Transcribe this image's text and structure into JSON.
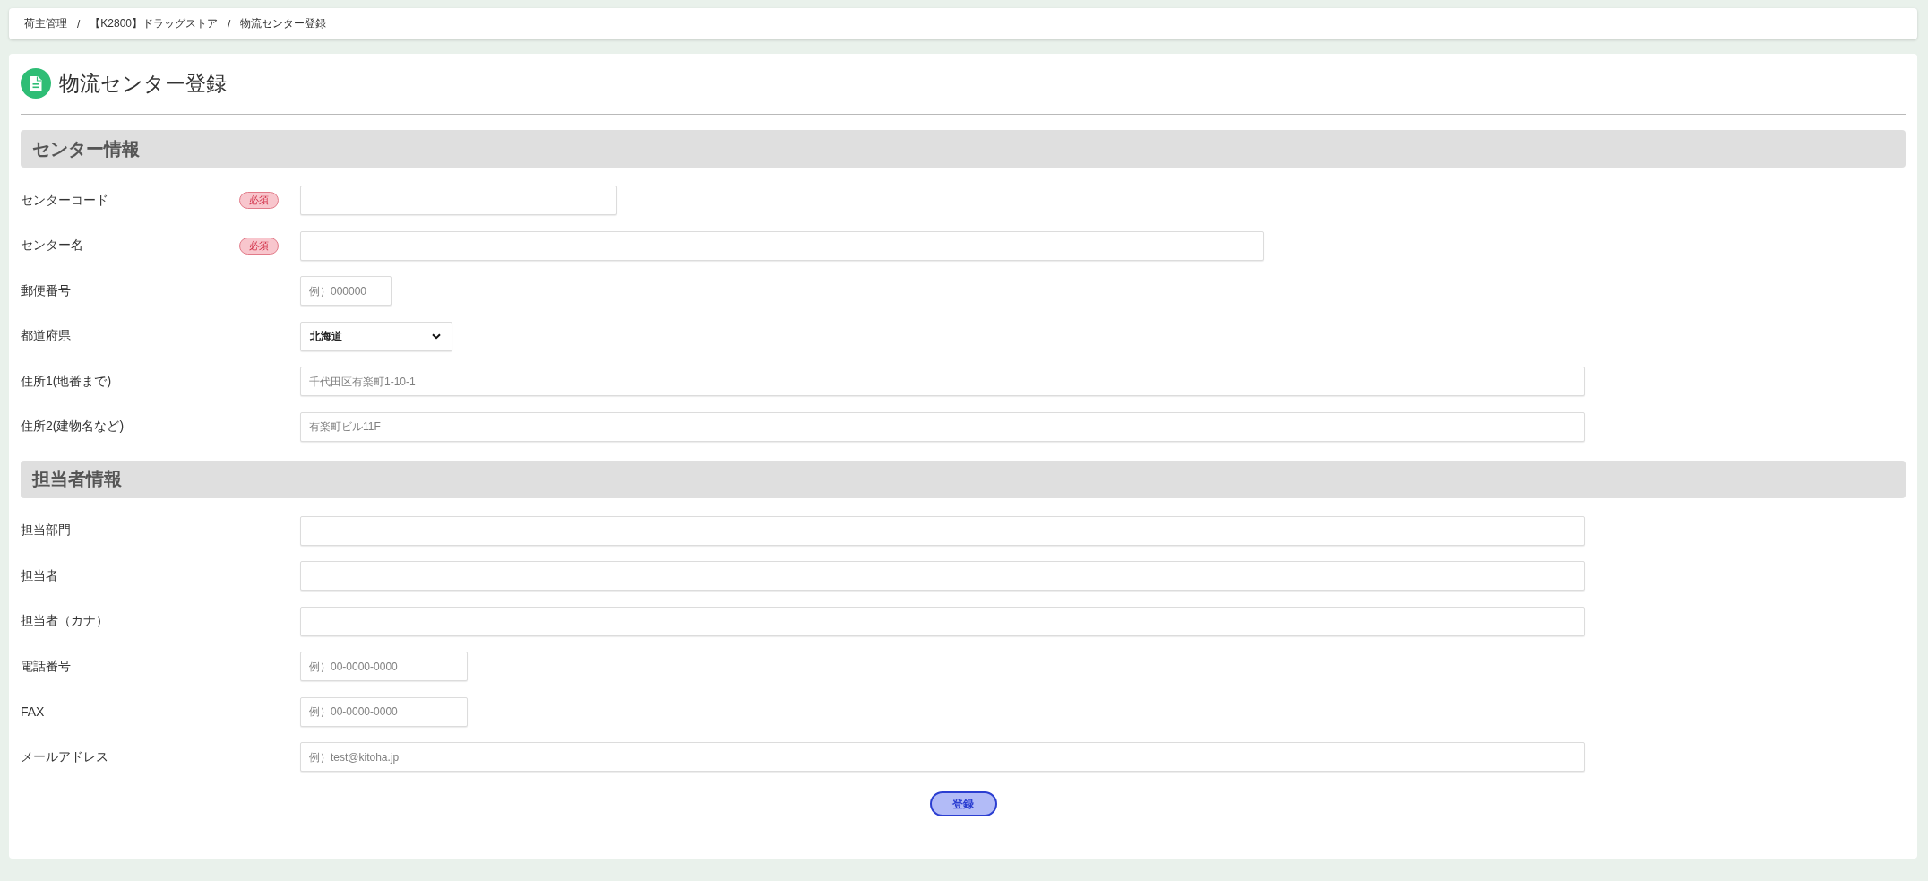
{
  "breadcrumb": {
    "items": [
      {
        "label": "荷主管理"
      },
      {
        "label": "【K2800】ドラッグストア"
      },
      {
        "label": "物流センター登録"
      }
    ],
    "separators": [
      "/",
      "/"
    ]
  },
  "page": {
    "title": "物流センター登録"
  },
  "sections": [
    {
      "title": "センター情報",
      "fields": [
        {
          "label": "センターコード",
          "badge": "必須",
          "kind": "code"
        },
        {
          "label": "センター名",
          "badge": "必須",
          "kind": "name"
        },
        {
          "label": "郵便番号",
          "kind": "postal",
          "placeholder": "例）000000"
        },
        {
          "label": "都道府県",
          "kind": "select",
          "value": "北海道"
        },
        {
          "label": "住所1(地番まで)",
          "kind": "text",
          "placeholder": "千代田区有楽町1-10-1"
        },
        {
          "label": "住所2(建物名など)",
          "kind": "text",
          "placeholder": "有楽町ビル11F"
        }
      ]
    },
    {
      "title": "担当者情報",
      "fields": [
        {
          "label": "担当部門",
          "kind": "text"
        },
        {
          "label": "担当者",
          "kind": "text"
        },
        {
          "label": "担当者（カナ）",
          "kind": "text"
        },
        {
          "label": "電話番号",
          "kind": "phone",
          "placeholder": "例）00-0000-0000"
        },
        {
          "label": "FAX",
          "kind": "phone",
          "placeholder": "例）00-0000-0000"
        },
        {
          "label": "メールアドレス",
          "kind": "text",
          "placeholder": "例）test@kitoha.jp"
        }
      ]
    }
  ],
  "submit_button": {
    "label": "登録"
  }
}
